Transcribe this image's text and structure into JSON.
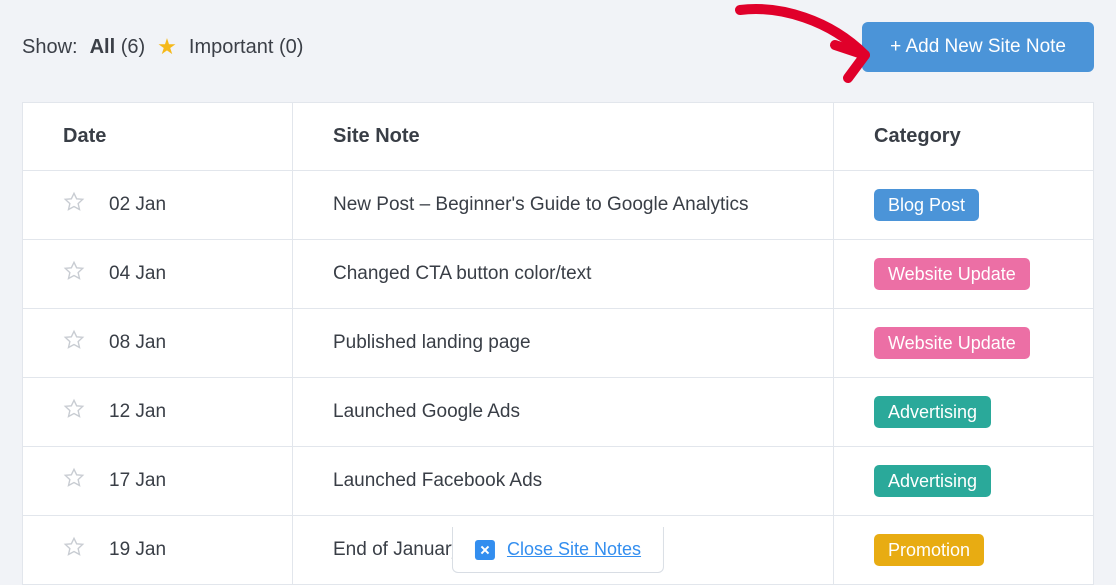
{
  "filter": {
    "show_label": "Show:",
    "all_label": "All",
    "all_count": "(6)",
    "important_label": "Important",
    "important_count": "(0)"
  },
  "buttons": {
    "add_note": "+ Add New Site Note",
    "close_notes": "Close Site Notes"
  },
  "columns": {
    "date": "Date",
    "note": "Site Note",
    "category": "Category"
  },
  "categories": {
    "blog_post": {
      "label": "Blog Post",
      "color": "#4b94d8"
    },
    "website_update": {
      "label": "Website Update",
      "color": "#ec6fa5"
    },
    "advertising": {
      "label": "Advertising",
      "color": "#2aa99a"
    },
    "promotion": {
      "label": "Promotion",
      "color": "#e8ac12"
    }
  },
  "rows": [
    {
      "date": "02 Jan",
      "note": "New Post – Beginner's Guide to Google Analytics",
      "category": "blog_post"
    },
    {
      "date": "04 Jan",
      "note": "Changed CTA button color/text",
      "category": "website_update"
    },
    {
      "date": "08 Jan",
      "note": "Published landing page",
      "category": "website_update"
    },
    {
      "date": "12 Jan",
      "note": "Launched Google Ads",
      "category": "advertising"
    },
    {
      "date": "17 Jan",
      "note": "Launched Facebook Ads",
      "category": "advertising"
    },
    {
      "date": "19 Jan",
      "note": "End of January Sale",
      "category": "promotion"
    }
  ]
}
